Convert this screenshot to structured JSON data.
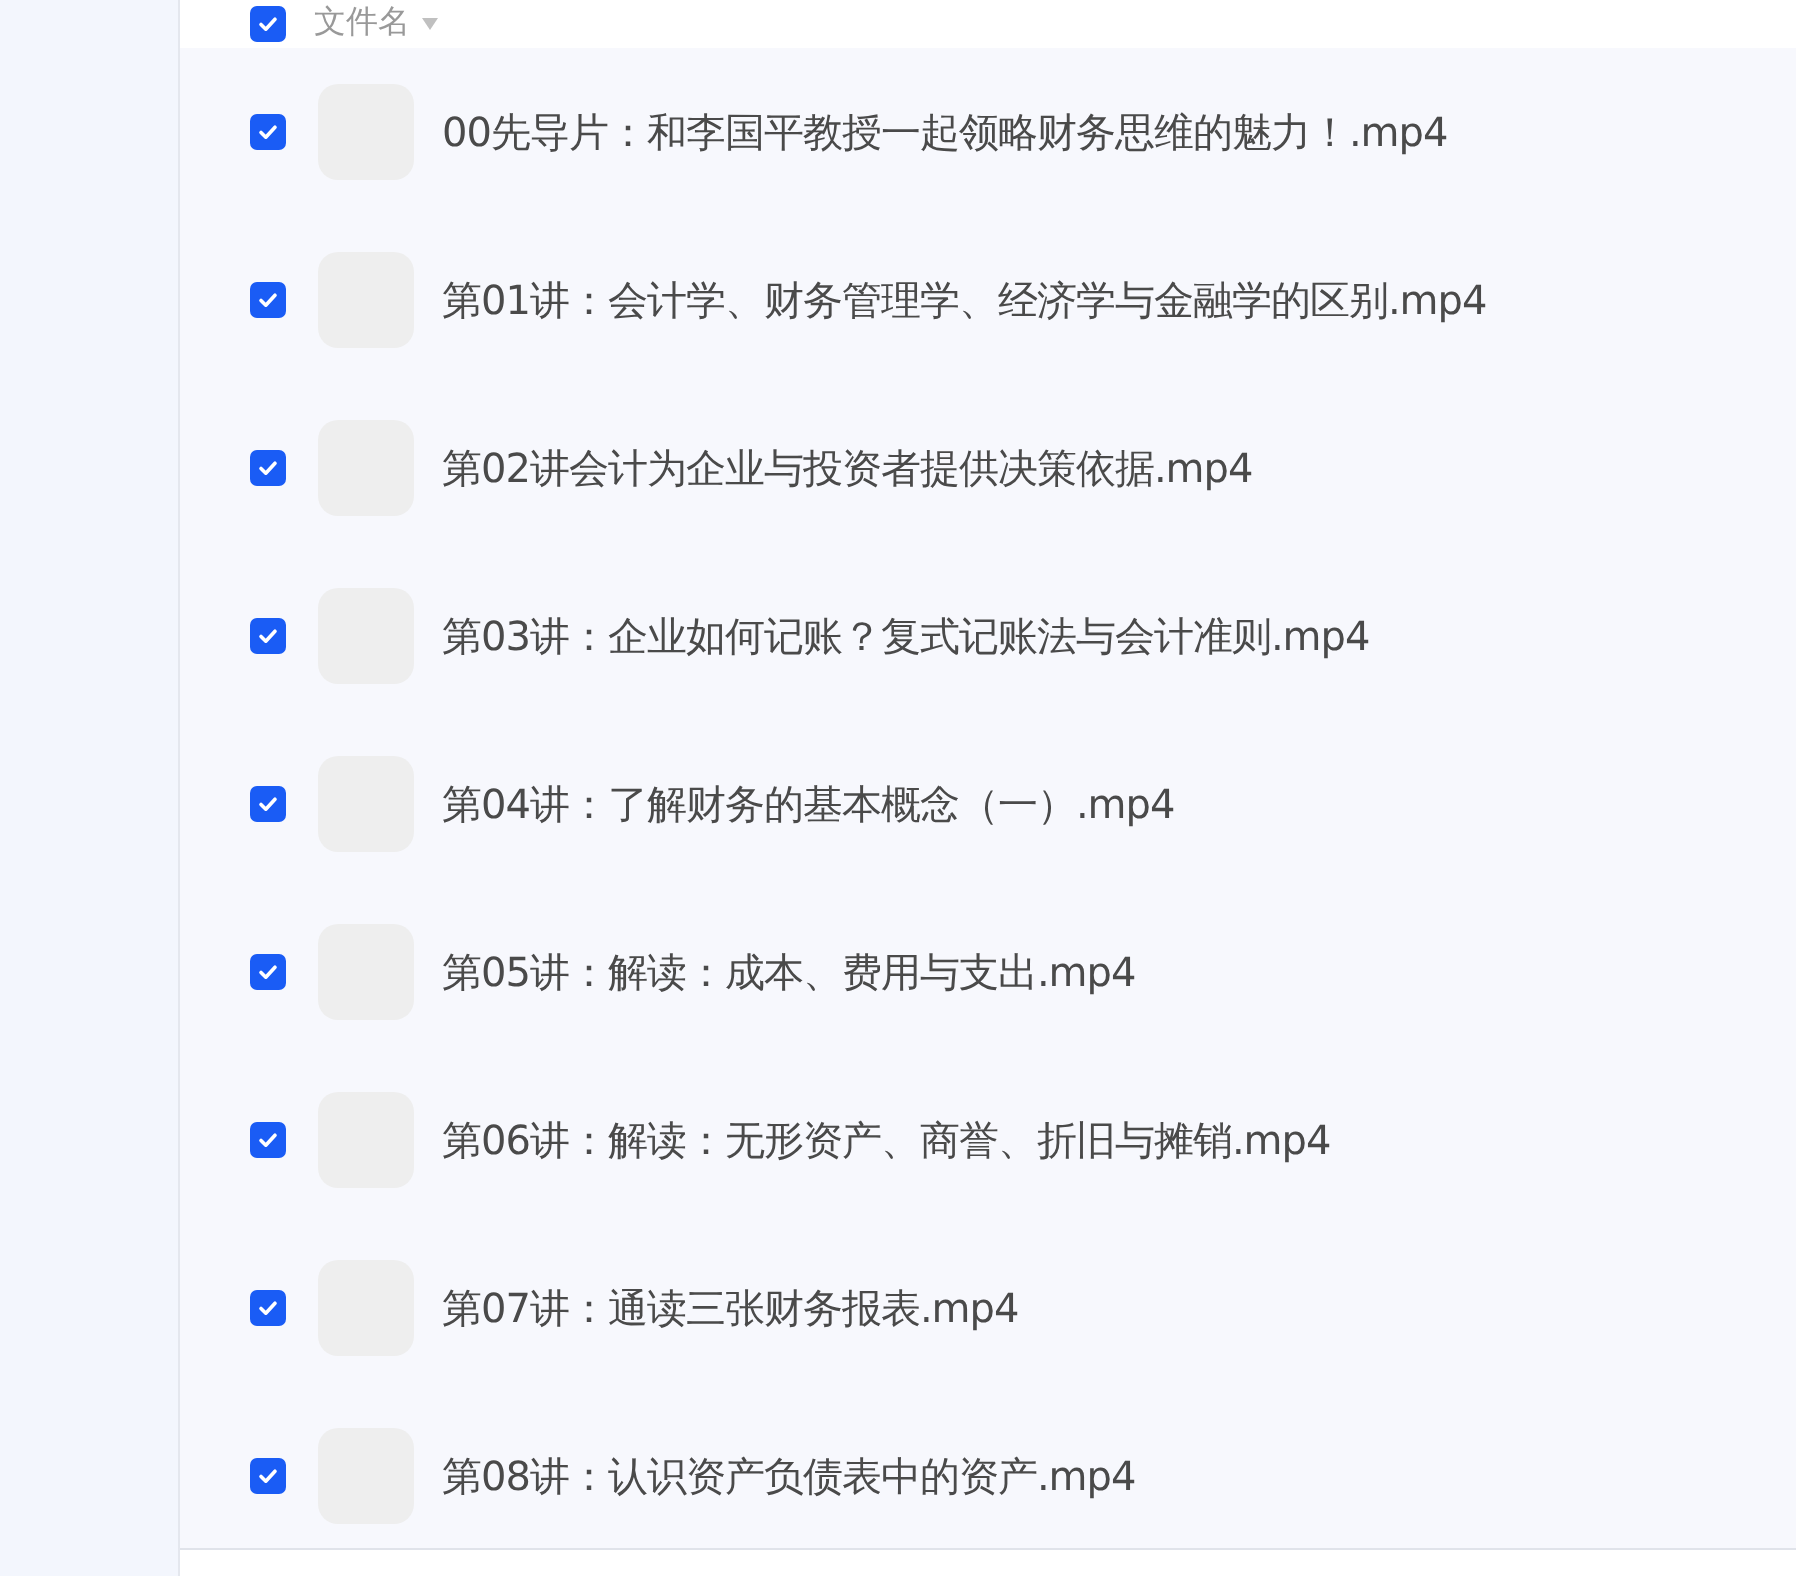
{
  "header": {
    "checked": true,
    "label": "文件名"
  },
  "files": [
    {
      "name": "00先导片：和李国平教授一起领略财务思维的魅力！.mp4",
      "checked": true
    },
    {
      "name": "第01讲：会计学、财务管理学、经济学与金融学的区别.mp4",
      "checked": true
    },
    {
      "name": "第02讲会计为企业与投资者提供决策依据.mp4",
      "checked": true
    },
    {
      "name": "第03讲：企业如何记账？复式记账法与会计准则.mp4",
      "checked": true
    },
    {
      "name": "第04讲：了解财务的基本概念（一）.mp4",
      "checked": true
    },
    {
      "name": "第05讲：解读：成本、费用与支出.mp4",
      "checked": true
    },
    {
      "name": "第06讲：解读：无形资产、商誉、折旧与摊销.mp4",
      "checked": true
    },
    {
      "name": "第07讲：通读三张财务报表.mp4",
      "checked": true
    },
    {
      "name": "第08讲：认识资产负债表中的资产.mp4",
      "checked": true
    }
  ]
}
